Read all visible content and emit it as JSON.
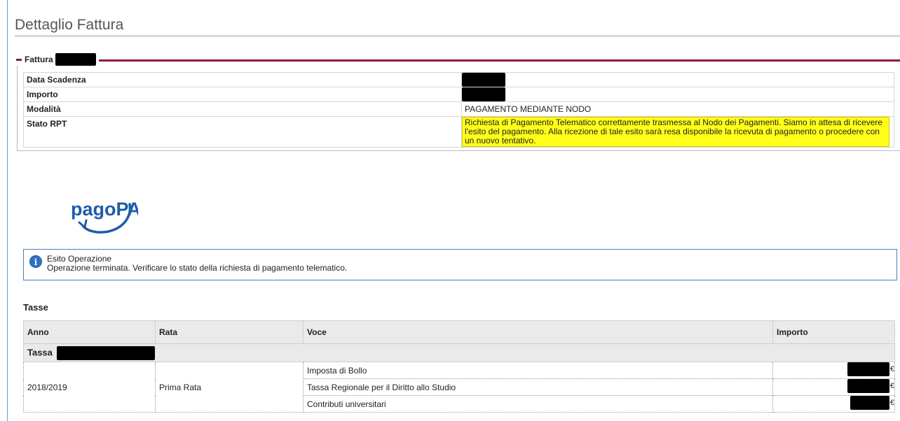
{
  "page": {
    "title": "Dettaglio Fattura"
  },
  "fattura": {
    "legend": "Fattura",
    "rows": [
      {
        "label": "Data Scadenza",
        "value": ""
      },
      {
        "label": "Importo",
        "value": ""
      },
      {
        "label": "Modalità",
        "value": "PAGAMENTO MEDIANTE NODO"
      },
      {
        "label": "Stato RPT",
        "value": "Richiesta di Pagamento Telematico correttamente trasmessa al Nodo dei Pagamenti. Siamo in attesa di ricevere l'esito del pagamento. Alla ricezione di tale esito sarà resa disponibile la ricevuta di pagamento o procedere con un nuovo tentativo."
      }
    ]
  },
  "logo": {
    "text": "pagoPA",
    "color": "#1f5da8"
  },
  "info": {
    "icon": "info-icon",
    "title": "Esito Operazione",
    "message": "Operazione terminata. Verificare lo stato della richiesta di pagamento telematico."
  },
  "tasse": {
    "heading": "Tasse",
    "columns": [
      "Anno",
      "Rata",
      "Voce",
      "Importo"
    ],
    "group_label": "Tassa",
    "anno": "2018/2019",
    "rata": "Prima Rata",
    "items": [
      {
        "voce": "Imposta di Bollo",
        "currency": "€"
      },
      {
        "voce": "Tassa Regionale per il Diritto allo Studio",
        "currency": "€"
      },
      {
        "voce": "Contributi universitari",
        "currency": "€"
      }
    ]
  },
  "colors": {
    "accent": "#8b1a4a",
    "highlight": "#ffff1a",
    "info_border": "#4a7fbf"
  }
}
